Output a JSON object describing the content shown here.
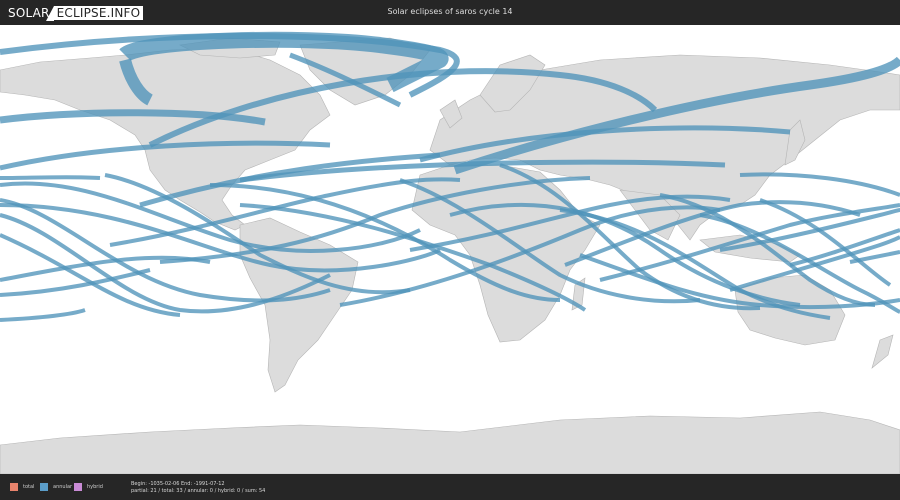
{
  "header": {
    "logo_part1": "SOLAR",
    "logo_part2": "ECLIPSE.INFO",
    "title": "Solar eclipses of saros cycle 14"
  },
  "legend": [
    {
      "label": "total",
      "color": "#e8836c"
    },
    {
      "label": "annular",
      "color": "#5b9dc9"
    },
    {
      "label": "hybrid",
      "color": "#c98bd6"
    }
  ],
  "stats": {
    "range": "Begin: -1035-02-06 End: -1991-07-12",
    "counts": "partial: 21 / total: 33 / annular: 0 / hybrid: 0 / sum: 54"
  },
  "colors": {
    "track": "#4f93ba",
    "land": "#dcdcdc",
    "ocean": "#ffffff",
    "bar": "#262626"
  }
}
